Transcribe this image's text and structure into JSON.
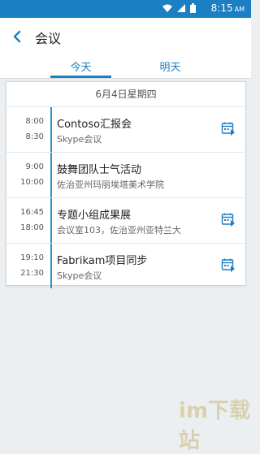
{
  "status_bar": {
    "time": "8:15",
    "ampm": "AM",
    "icons": [
      "wifi-icon",
      "signal-icon",
      "battery-icon"
    ],
    "color": "#1a7fc3"
  },
  "app_bar": {
    "title": "会议",
    "back_icon": "chevron-left-icon"
  },
  "tabs": [
    {
      "label": "今天",
      "selected": true
    },
    {
      "label": "明天",
      "selected": false
    }
  ],
  "day_card": {
    "date": "6月4日星期四",
    "events": [
      {
        "start": "8:00",
        "end": "8:30",
        "title": "Contoso汇报会",
        "subtitle": "Skype会议",
        "has_action_icon": true
      },
      {
        "start": "9:00",
        "end": "10:00",
        "title": "鼓舞团队士气活动",
        "subtitle": "佐治亚州玛丽埃塔美术学院",
        "has_action_icon": false
      },
      {
        "start": "16:45",
        "end": "18:00",
        "title": "专题小组成果展",
        "subtitle": "会议室103，佐治亚州亚特兰大",
        "has_action_icon": true
      },
      {
        "start": "19:10",
        "end": "21:30",
        "title": "Fabrikam项目同步",
        "subtitle": "Skype会议",
        "has_action_icon": true
      }
    ]
  },
  "colors": {
    "accent": "#1a7fc3",
    "background": "#eceff1"
  },
  "watermark": {
    "text": "im下载站"
  }
}
